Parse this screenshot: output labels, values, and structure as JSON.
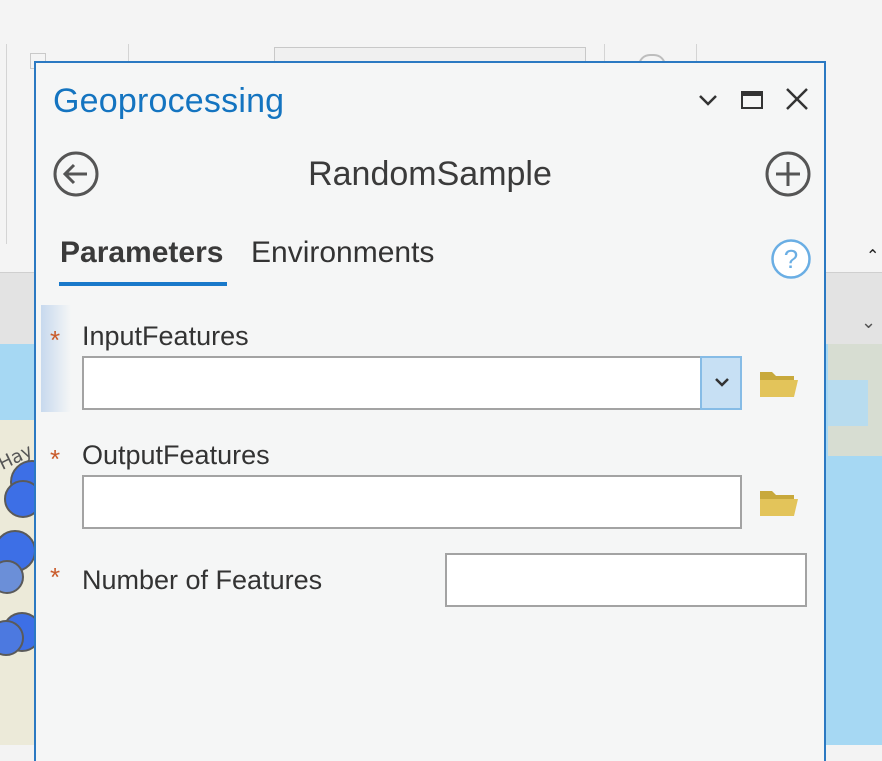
{
  "background": {
    "map_label": "Hay"
  },
  "pane": {
    "title": "Geoprocessing",
    "tool_name": "RandomSample",
    "tabs": [
      {
        "label": "Parameters",
        "active": true
      },
      {
        "label": "Environments",
        "active": false
      }
    ],
    "icons": {
      "collapse": "chevron-down-icon",
      "maximize": "maximize-icon",
      "close": "close-icon",
      "back": "back-arrow-icon",
      "add": "add-icon",
      "help": "help-icon",
      "browse": "folder-icon"
    },
    "parameters": [
      {
        "label": "InputFeatures",
        "required_mark": "*",
        "value": "",
        "type": "combo"
      },
      {
        "label": "OutputFeatures",
        "required_mark": "*",
        "value": "",
        "type": "text"
      },
      {
        "label": "Number of Features",
        "required_mark": "*",
        "value": "",
        "type": "text"
      }
    ]
  },
  "colors": {
    "accent": "#1474c0",
    "required": "#c95b2b",
    "folder": "#e3c45a"
  }
}
